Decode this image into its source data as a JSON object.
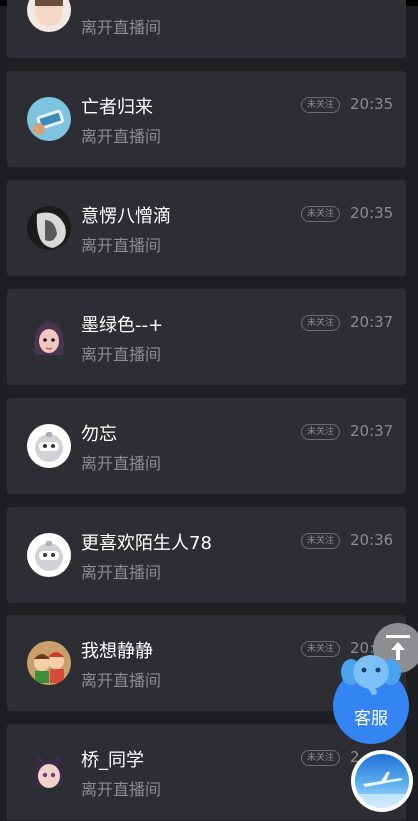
{
  "feed": {
    "items": [
      {
        "name": "",
        "status": "离开直播间",
        "badge": "",
        "time": "",
        "avatar": "avatar-cartoon-icon"
      },
      {
        "name": "亡者归来",
        "status": "离开直播间",
        "badge": "未关注",
        "time": "20:35",
        "avatar": "avatar-phone-photo-icon"
      },
      {
        "name": "意愣八憎滴",
        "status": "离开直播间",
        "badge": "未关注",
        "time": "20:35",
        "avatar": "avatar-bw-face-icon"
      },
      {
        "name": "墨绿色--+",
        "status": "离开直播间",
        "badge": "未关注",
        "time": "20:37",
        "avatar": "avatar-3d-girl-icon"
      },
      {
        "name": "勿忘",
        "status": "离开直播间",
        "badge": "未关注",
        "time": "20:37",
        "avatar": "avatar-robot-icon"
      },
      {
        "name": "更喜欢陌生人78",
        "status": "离开直播间",
        "badge": "未关注",
        "time": "20:36",
        "avatar": "avatar-robot-icon"
      },
      {
        "name": "我想静静",
        "status": "离开直播间",
        "badge": "未关注",
        "time": "20:3",
        "avatar": "avatar-kids-cartoon-icon"
      },
      {
        "name": "桥_同学",
        "status": "离开直播间",
        "badge": "未关注",
        "time": "2",
        "avatar": "avatar-cat-girl-icon"
      }
    ]
  },
  "widgets": {
    "service_label": "客服",
    "scroll_top_icon": "arrow-up-to-top-icon",
    "service_icon": "elephant-mascot-icon",
    "fab_icon": "airplane-sky-icon"
  },
  "colors": {
    "background": "#1e1f23",
    "card": "#2d2e33",
    "name_text": "#ffffff",
    "muted_text": "#8b8c91",
    "service_blue": "#3584f4"
  }
}
